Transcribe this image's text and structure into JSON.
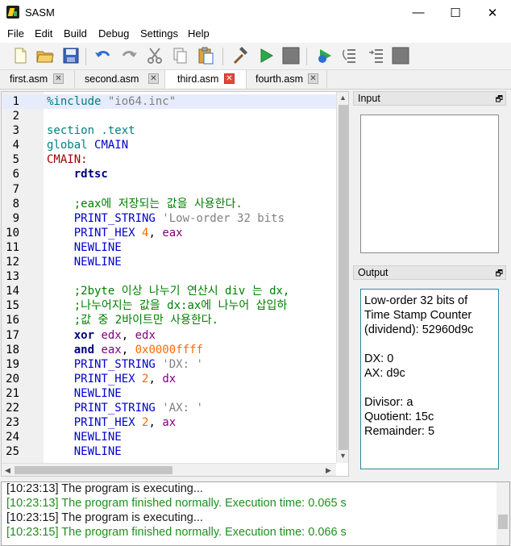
{
  "window": {
    "title": "SASM",
    "minimize": "—",
    "maximize": "☐",
    "close": "✕"
  },
  "menu": [
    "File",
    "Edit",
    "Build",
    "Debug",
    "Settings",
    "Help"
  ],
  "tabs": [
    {
      "label": "first.asm",
      "close": "✕"
    },
    {
      "label": "second.asm",
      "close": "✕"
    },
    {
      "label": "third.asm",
      "close": "✕",
      "active": true
    },
    {
      "label": "fourth.asm",
      "close": "✕"
    }
  ],
  "editor": {
    "line_numbers": [
      "1",
      "2",
      "3",
      "4",
      "5",
      "6",
      "7",
      "8",
      "9",
      "10",
      "11",
      "12",
      "13",
      "14",
      "15",
      "16",
      "17",
      "18",
      "19",
      "20",
      "21",
      "22",
      "23",
      "24",
      "25"
    ],
    "lines": [
      [
        {
          "t": "%include ",
          "c": "kw"
        },
        {
          "t": "\"io64.inc\"",
          "c": "str"
        }
      ],
      [],
      [
        {
          "t": "section .text",
          "c": "kw"
        }
      ],
      [
        {
          "t": "global ",
          "c": "kw"
        },
        {
          "t": "CMAIN",
          "c": "macro"
        }
      ],
      [
        {
          "t": "CMAIN:",
          "c": "lbl"
        }
      ],
      [
        {
          "t": "    rdtsc",
          "c": "instr"
        }
      ],
      [],
      [
        {
          "t": "    ;eax에 저장되는 값을 사용한다.",
          "c": "com"
        }
      ],
      [
        {
          "t": "    PRINT_STRING ",
          "c": "macro"
        },
        {
          "t": "'Low-order 32 bits",
          "c": "str"
        }
      ],
      [
        {
          "t": "    PRINT_HEX ",
          "c": "macro"
        },
        {
          "t": "4",
          "c": "num"
        },
        {
          "t": ", ",
          "c": "plain"
        },
        {
          "t": "eax",
          "c": "reg"
        }
      ],
      [
        {
          "t": "    NEWLINE",
          "c": "macro"
        }
      ],
      [
        {
          "t": "    NEWLINE",
          "c": "macro"
        }
      ],
      [],
      [
        {
          "t": "    ;2byte 이상 나누기 연산시 div 는 dx,",
          "c": "com"
        }
      ],
      [
        {
          "t": "    ;나누어지는 값을 dx:ax에 나누어 삽입하",
          "c": "com"
        }
      ],
      [
        {
          "t": "    ;값 중 2바이트만 사용한다.",
          "c": "com"
        }
      ],
      [
        {
          "t": "    xor ",
          "c": "instr"
        },
        {
          "t": "edx",
          "c": "reg"
        },
        {
          "t": ", ",
          "c": "plain"
        },
        {
          "t": "edx",
          "c": "reg"
        }
      ],
      [
        {
          "t": "    and ",
          "c": "instr"
        },
        {
          "t": "eax",
          "c": "reg"
        },
        {
          "t": ", ",
          "c": "plain"
        },
        {
          "t": "0x0000ffff",
          "c": "num"
        }
      ],
      [
        {
          "t": "    PRINT_STRING ",
          "c": "macro"
        },
        {
          "t": "'DX: '",
          "c": "str"
        }
      ],
      [
        {
          "t": "    PRINT_HEX ",
          "c": "macro"
        },
        {
          "t": "2",
          "c": "num"
        },
        {
          "t": ", ",
          "c": "plain"
        },
        {
          "t": "dx",
          "c": "reg"
        }
      ],
      [
        {
          "t": "    NEWLINE",
          "c": "macro"
        }
      ],
      [
        {
          "t": "    PRINT_STRING ",
          "c": "macro"
        },
        {
          "t": "'AX: '",
          "c": "str"
        }
      ],
      [
        {
          "t": "    PRINT_HEX ",
          "c": "macro"
        },
        {
          "t": "2",
          "c": "num"
        },
        {
          "t": ", ",
          "c": "plain"
        },
        {
          "t": "ax",
          "c": "reg"
        }
      ],
      [
        {
          "t": "    NEWLINE",
          "c": "macro"
        }
      ],
      [
        {
          "t": "    NEWLINE",
          "c": "macro"
        }
      ]
    ]
  },
  "input_panel": {
    "title": "Input",
    "restore": "🗗"
  },
  "output_panel": {
    "title": "Output",
    "restore": "🗗",
    "lines": [
      "Low-order 32 bits of",
      "Time Stamp Counter",
      "(dividend): 52960d9c",
      "",
      "DX: 0",
      "AX: d9c",
      "",
      "Divisor: a",
      "Quotient: 15c",
      "Remainder: 5"
    ]
  },
  "log": [
    {
      "text": "[10:23:13] The program is executing...",
      "kind": "info"
    },
    {
      "text": "[10:23:13] The program finished normally. Execution time: 0.065 s",
      "kind": "ok"
    },
    {
      "text": "[10:23:15] The program is executing...",
      "kind": "info"
    },
    {
      "text": "[10:23:15] The program finished normally. Execution time: 0.066 s",
      "kind": "ok"
    }
  ],
  "colors": {
    "accent": "#2b8a9a",
    "tab_close_active": "#e8443a",
    "ok_text": "#1f8f1f"
  },
  "toolbar_icons": [
    "new-file-icon",
    "open-folder-icon",
    "save-icon",
    "undo-icon",
    "redo-icon",
    "cut-icon",
    "copy-icon",
    "paste-icon",
    "build-hammer-icon",
    "run-play-icon",
    "stop-icon",
    "debug-icon",
    "step-over-icon",
    "step-into-icon",
    "debug-stop-icon"
  ]
}
